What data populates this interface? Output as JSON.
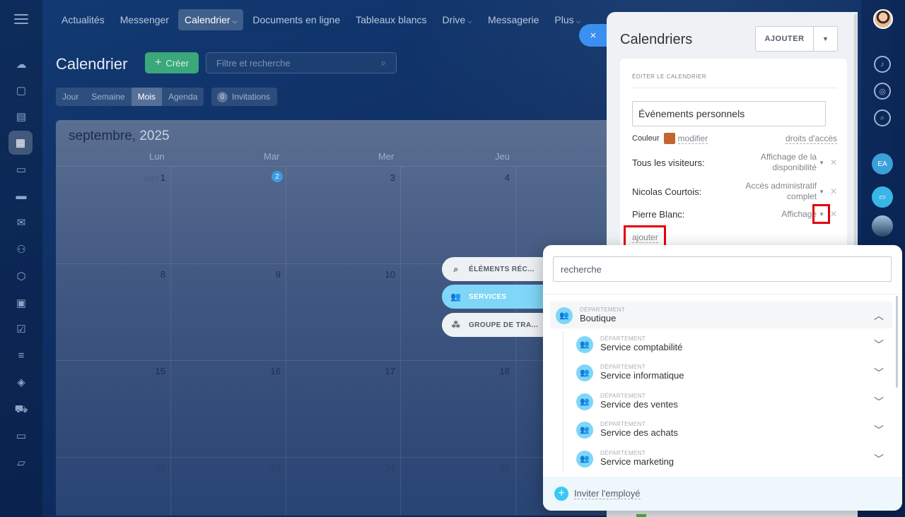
{
  "nav": {
    "items": [
      {
        "label": "Actualités",
        "caret": false,
        "active": false
      },
      {
        "label": "Messenger",
        "caret": false,
        "active": false
      },
      {
        "label": "Calendrier",
        "caret": true,
        "active": true
      },
      {
        "label": "Documents en ligne",
        "caret": false,
        "active": false
      },
      {
        "label": "Tableaux blancs",
        "caret": false,
        "active": false
      },
      {
        "label": "Drive",
        "caret": true,
        "active": false
      },
      {
        "label": "Messagerie",
        "caret": false,
        "active": false
      },
      {
        "label": "Plus",
        "caret": true,
        "active": false
      }
    ]
  },
  "header": {
    "title": "Calendrier",
    "create_label": "Créer",
    "search_placeholder": "Filtre et recherche"
  },
  "views": [
    {
      "label": "Jour",
      "active": false
    },
    {
      "label": "Semaine",
      "active": false
    },
    {
      "label": "Mois",
      "active": true
    },
    {
      "label": "Agenda",
      "active": false
    }
  ],
  "invitations": {
    "count": "0",
    "label": "Invitations"
  },
  "calendar": {
    "month": "septembre,",
    "year": "2025",
    "weekdays": [
      "Lun",
      "Mar",
      "Mer",
      "Jeu"
    ],
    "first_prefix": "sept",
    "weeks": [
      [
        "1",
        "2",
        "3",
        "4"
      ],
      [
        "8",
        "9",
        "10",
        ""
      ],
      [
        "15",
        "16",
        "17",
        "18"
      ],
      [
        "22",
        "23",
        "24",
        "25"
      ]
    ],
    "today": "2"
  },
  "right_rail": {
    "user_initials": "EA"
  },
  "slider": {
    "close_label": "×",
    "title": "Calendriers",
    "add_label": "AJOUTER",
    "section_label": "ÉDITER LE CALENDRIER",
    "calendar_name": "Événements personnels",
    "color_label": "Couleur",
    "color_hex": "#c3652d",
    "modify_label": "modifier",
    "access_label": "droits d'accès",
    "permissions": [
      {
        "name": "Tous les visiteurs:",
        "value_line1": "Affichage de la",
        "value_line2": "disponibilité"
      },
      {
        "name": "Nicolas Courtois:",
        "value_line1": "Accès administratif",
        "value_line2": "complet"
      },
      {
        "name": "Pierre Blanc:",
        "value_line1": "Affichage",
        "value_line2": ""
      }
    ],
    "add_link": "ajouter"
  },
  "selector": {
    "tabs": [
      {
        "label": "ÉLÉMENTS RÉC...",
        "icon": "search-list-icon",
        "active": false
      },
      {
        "label": "SERVICES",
        "icon": "people-icon",
        "active": true
      },
      {
        "label": "GROUPE DE TRA...",
        "icon": "group-icon",
        "active": false
      }
    ],
    "search_placeholder": "recherche",
    "department_kind": "DÉPARTEMENT",
    "root": "Boutique",
    "children": [
      "Service comptabilité",
      "Service informatique",
      "Service des ventes",
      "Service des achats",
      "Service marketing"
    ],
    "invite_label": "Inviter l'employé"
  },
  "colors": {
    "accent": "#3bc8f5",
    "create_button": "#3aa87a",
    "highlight": "#e3000f"
  }
}
